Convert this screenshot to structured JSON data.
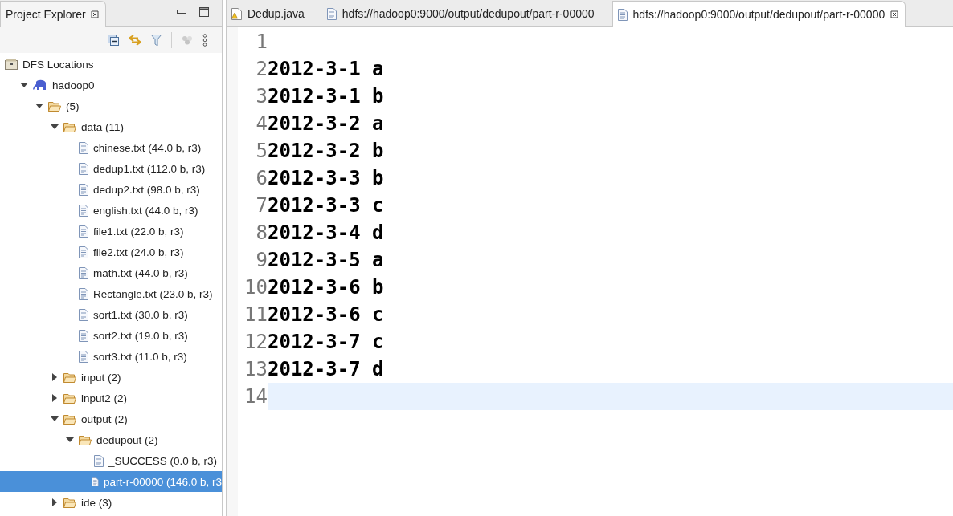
{
  "explorer": {
    "title": "Project Explorer",
    "tree": [
      {
        "label": "DFS Locations",
        "kind": "location",
        "selected": false,
        "children": [
          {
            "label": "hadoop0",
            "kind": "server",
            "expanded": true,
            "selected": false,
            "children": [
              {
                "label": "(5)",
                "kind": "folder",
                "expanded": true,
                "selected": false,
                "children": [
                  {
                    "label": "data (11)",
                    "kind": "folder",
                    "expanded": true,
                    "selected": false,
                    "children": [
                      {
                        "label": "chinese.txt (44.0 b, r3)",
                        "kind": "file",
                        "selected": false
                      },
                      {
                        "label": "dedup1.txt (112.0 b, r3)",
                        "kind": "file",
                        "selected": false
                      },
                      {
                        "label": "dedup2.txt (98.0 b, r3)",
                        "kind": "file",
                        "selected": false
                      },
                      {
                        "label": "english.txt (44.0 b, r3)",
                        "kind": "file",
                        "selected": false
                      },
                      {
                        "label": "file1.txt (22.0 b, r3)",
                        "kind": "file",
                        "selected": false
                      },
                      {
                        "label": "file2.txt (24.0 b, r3)",
                        "kind": "file",
                        "selected": false
                      },
                      {
                        "label": "math.txt (44.0 b, r3)",
                        "kind": "file",
                        "selected": false
                      },
                      {
                        "label": "Rectangle.txt (23.0 b, r3)",
                        "kind": "file",
                        "selected": false
                      },
                      {
                        "label": "sort1.txt (30.0 b, r3)",
                        "kind": "file",
                        "selected": false
                      },
                      {
                        "label": "sort2.txt (19.0 b, r3)",
                        "kind": "file",
                        "selected": false
                      },
                      {
                        "label": "sort3.txt (11.0 b, r3)",
                        "kind": "file",
                        "selected": false
                      }
                    ]
                  },
                  {
                    "label": "input (2)",
                    "kind": "folder",
                    "expanded": false,
                    "selected": false
                  },
                  {
                    "label": "input2 (2)",
                    "kind": "folder",
                    "expanded": false,
                    "selected": false
                  },
                  {
                    "label": "output (2)",
                    "kind": "folder",
                    "expanded": true,
                    "selected": false,
                    "children": [
                      {
                        "label": "dedupout (2)",
                        "kind": "folder",
                        "expanded": true,
                        "selected": false,
                        "children": [
                          {
                            "label": "_SUCCESS (0.0 b, r3)",
                            "kind": "file",
                            "selected": false
                          },
                          {
                            "label": "part-r-00000 (146.0 b, r3",
                            "kind": "file",
                            "selected": true
                          }
                        ]
                      }
                    ]
                  },
                  {
                    "label": "ide (3)",
                    "kind": "folder",
                    "expanded": false,
                    "selected": false
                  }
                ]
              }
            ]
          }
        ]
      }
    ]
  },
  "tabs": [
    {
      "label": "Dedup.java",
      "kind": "java",
      "selected": false
    },
    {
      "label": "hdfs://hadoop0:9000/output/dedupout/part-r-00000",
      "kind": "file",
      "selected": false
    },
    {
      "label": "hdfs://hadoop0:9000/output/dedupout/part-r-00000",
      "kind": "file",
      "selected": true
    }
  ],
  "lines": [
    {
      "number": "1",
      "current": false
    },
    {
      "number": "2",
      "text": "2012-3-1 a",
      "current": false
    },
    {
      "number": "3",
      "text": "2012-3-1 b",
      "current": false
    },
    {
      "number": "4",
      "text": "2012-3-2 a",
      "current": false
    },
    {
      "number": "5",
      "text": "2012-3-2 b",
      "current": false
    },
    {
      "number": "6",
      "text": "2012-3-3 b",
      "current": false
    },
    {
      "number": "7",
      "text": "2012-3-3 c",
      "current": false
    },
    {
      "number": "8",
      "text": "2012-3-4 d",
      "current": false
    },
    {
      "number": "9",
      "text": "2012-3-5 a",
      "current": false
    },
    {
      "number": "10",
      "text": "2012-3-6 b",
      "current": false
    },
    {
      "number": "11",
      "text": "2012-3-6 c",
      "current": false
    },
    {
      "number": "12",
      "text": "2012-3-7 c",
      "current": false
    },
    {
      "number": "13",
      "text": "2012-3-7 d",
      "current": false
    },
    {
      "number": "14",
      "current": true
    }
  ]
}
